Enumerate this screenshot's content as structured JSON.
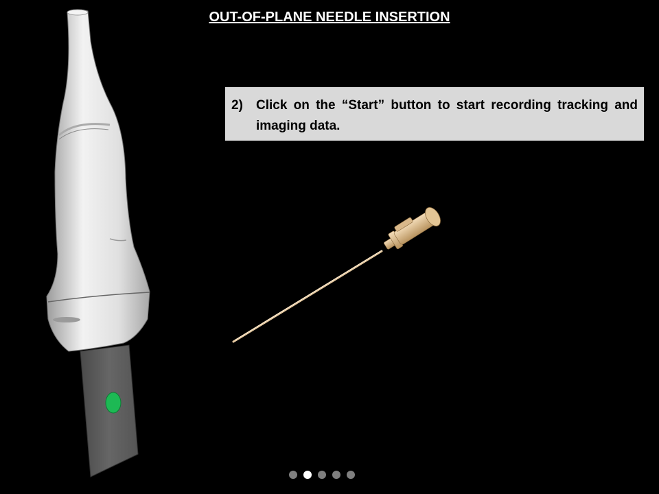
{
  "header": {
    "title": "OUT-OF-PLANE NEEDLE INSERTION"
  },
  "instruction": {
    "step": "2)",
    "text": "Click on the “Start” button to start recording tracking and imaging data."
  },
  "pagination": {
    "total": 5,
    "current": 2
  },
  "colors": {
    "marker": "#1db954",
    "needle": "#e6c9a0",
    "probe": "#e8e8e8",
    "tip_plate": "#595959"
  }
}
